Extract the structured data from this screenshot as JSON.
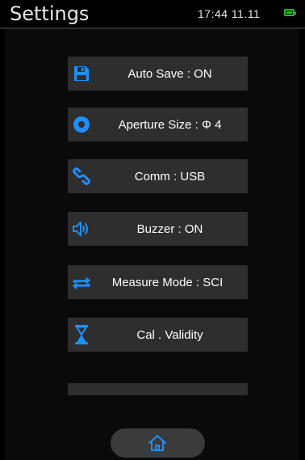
{
  "header": {
    "title": "Settings",
    "time": "17:44  11.11"
  },
  "menu": [
    {
      "label": "Auto Save : ON",
      "icon": "save-icon"
    },
    {
      "label": "Aperture Size : Φ 4",
      "icon": "aperture-icon"
    },
    {
      "label": "Comm : USB",
      "icon": "link-icon"
    },
    {
      "label": "Buzzer : ON",
      "icon": "speaker-icon"
    },
    {
      "label": "Measure Mode : SCI",
      "icon": "repeat-icon"
    },
    {
      "label": "Cal . Validity",
      "icon": "hourglass-icon"
    },
    {
      "label": "",
      "icon": ""
    }
  ],
  "colors": {
    "accent": "#1e8fff",
    "battery": "#19c419",
    "button_bg": "#2e2e2e"
  }
}
